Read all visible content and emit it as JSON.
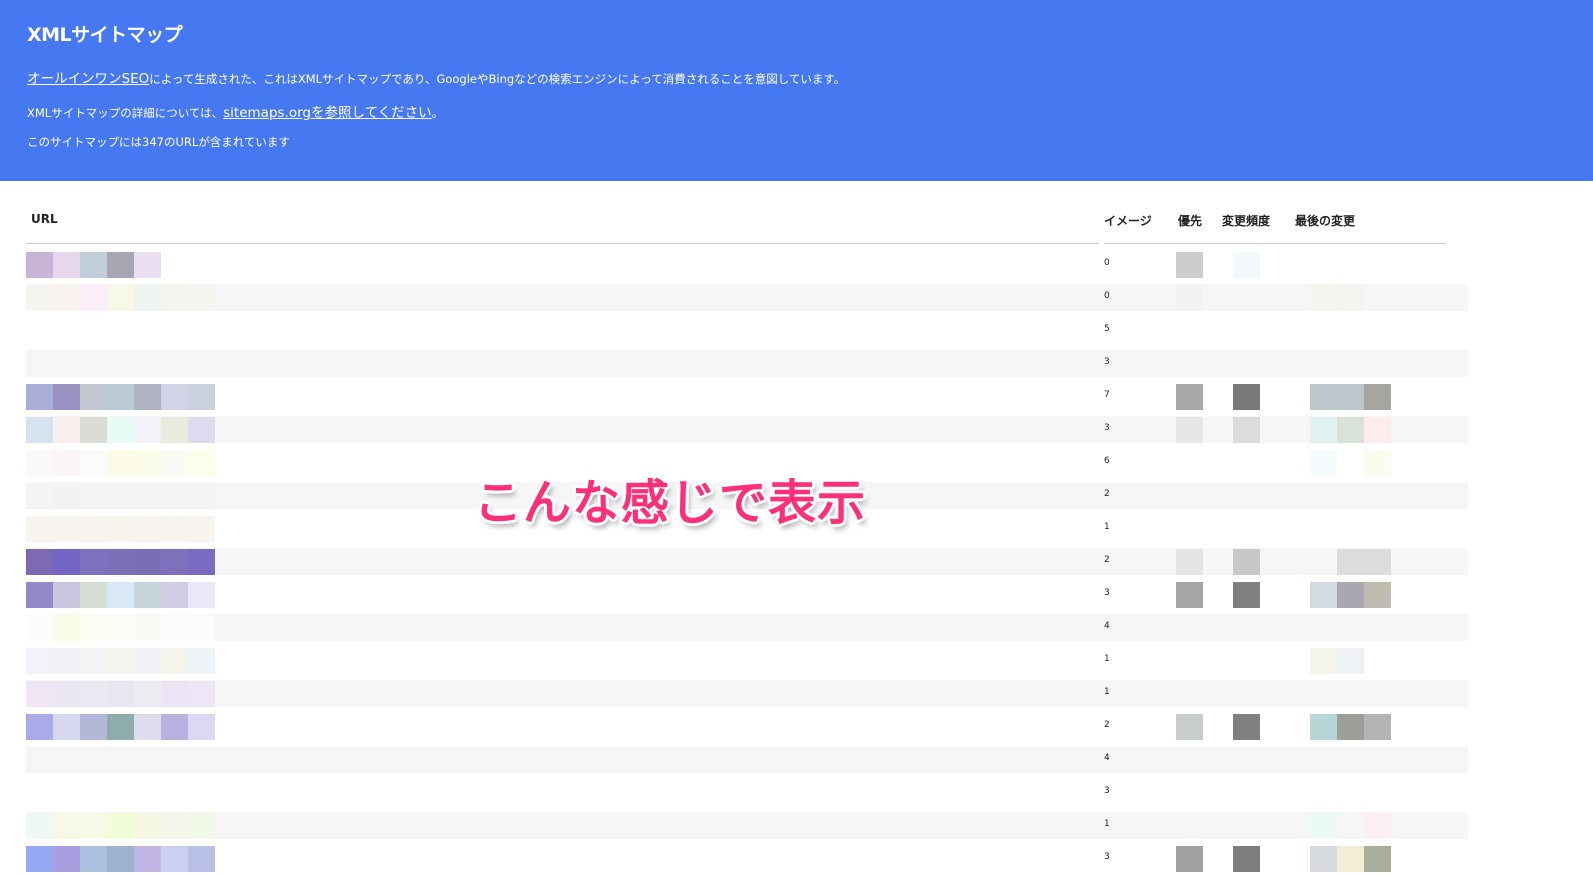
{
  "header": {
    "title": "XMLサイトマップ",
    "line1_link": "オールインワンSEO",
    "line1_text": "によって生成された、これはXMLサイトマップであり、GoogleやBingなどの検索エンジンによって消費されることを意図しています。",
    "line2_text": "XMLサイトマップの詳細については、",
    "line2_link": "sitemaps.orgを参照してください",
    "line2_end": "。",
    "line3_text": "このサイトマップには347のURLが含まれています"
  },
  "table": {
    "columns": [
      "URL",
      "イメージ",
      "優先",
      "変更頻度",
      "最後の変更"
    ],
    "image_counts": [
      "0",
      "0",
      "5",
      "3",
      "7",
      "3",
      "6",
      "2",
      "1",
      "2",
      "3",
      "4",
      "1",
      "1",
      "2",
      "4",
      "3",
      "1",
      "3"
    ]
  },
  "annotation": "こんな感じで表示",
  "colors": {
    "header_bg": "#4678f2",
    "annotation": "#ff2f78",
    "stripe": "#f6f6f6"
  }
}
